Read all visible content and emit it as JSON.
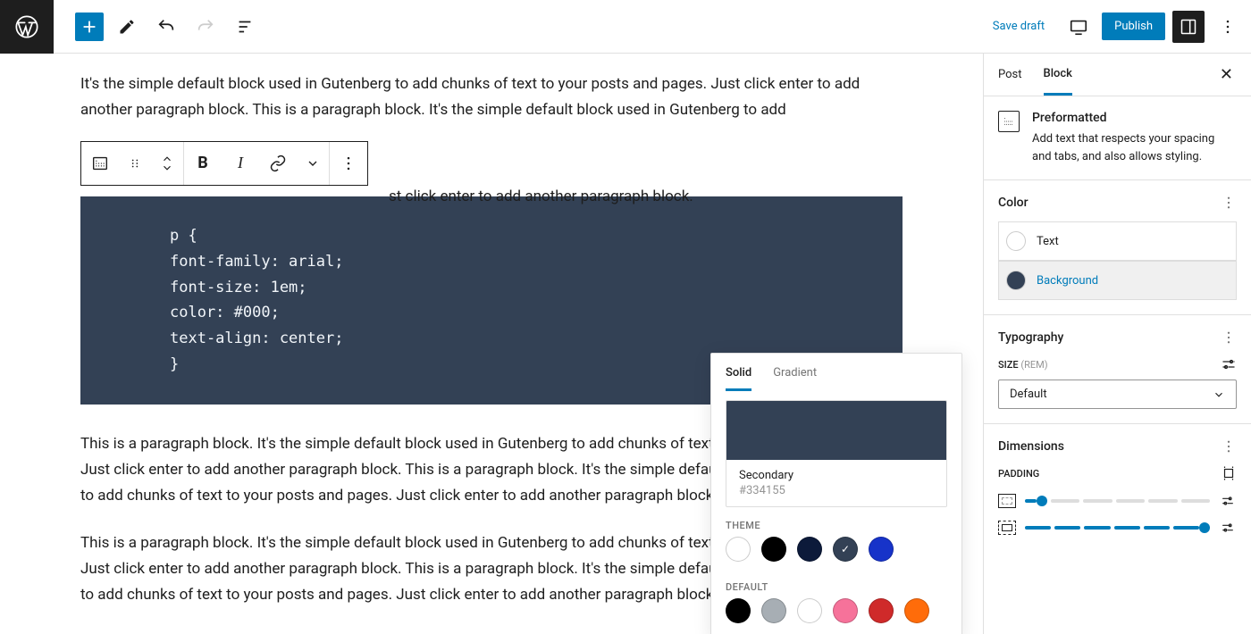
{
  "topbar": {
    "save_draft": "Save draft",
    "publish": "Publish"
  },
  "editor": {
    "para1": "It's the simple default block used in Gutenberg to add chunks of text to your posts and pages. Just click enter to add another paragraph block. This is a paragraph block. It's the simple default block used in Gutenberg to add",
    "floating_tail": "st click enter to add another paragraph block.",
    "code": "p {\nfont-family: arial;\nfont-size: 1em;\ncolor: #000;\ntext-align: center;\n}",
    "para2": "This is a paragraph block. It's the simple default block used in Gutenberg to add chunks of text to your posts and pages. Just click enter to add another paragraph block. This is a paragraph block. It's the simple default block used in Gutenberg to add chunks of text to your posts and pages. Just click enter to add another paragraph block.",
    "para3": "This is a paragraph block. It's the simple default block used in Gutenberg to add chunks of text to your posts and pages. Just click enter to add another paragraph block. This is a paragraph block. It's the simple default block used in Gutenberg to add chunks of text to your posts and pages. Just click enter to add another paragraph block."
  },
  "popover": {
    "tabs": {
      "solid": "Solid",
      "gradient": "Gradient"
    },
    "selected_name": "Secondary",
    "selected_hex": "#334155",
    "theme_label": "THEME",
    "default_label": "DEFAULT",
    "theme_colors": [
      "#ffffff",
      "#000000",
      "#0c1a3a",
      "#334155",
      "#1733c9"
    ],
    "default_colors": [
      "#000000",
      "#a7aeb4",
      "#ffffff",
      "#f6729a",
      "#cf2a2a",
      "#ff6c0a"
    ]
  },
  "sidebar": {
    "tabs": {
      "post": "Post",
      "block": "Block"
    },
    "block": {
      "title": "Preformatted",
      "desc": "Add text that respects your spacing and tabs, and also allows styling."
    },
    "color": {
      "title": "Color",
      "text": "Text",
      "background": "Background",
      "bg_value": "#334155"
    },
    "typography": {
      "title": "Typography",
      "size_label": "SIZE",
      "size_unit": "(REM)",
      "size_value": "Default"
    },
    "dimensions": {
      "title": "Dimensions",
      "padding_label": "PADDING"
    }
  }
}
